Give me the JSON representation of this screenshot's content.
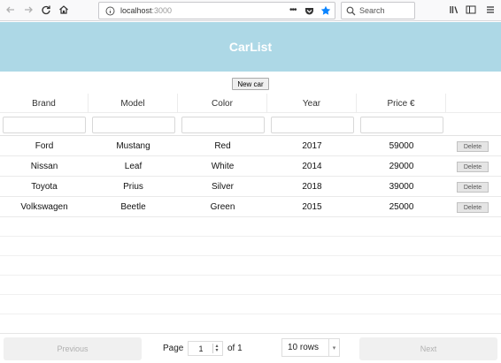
{
  "browser": {
    "url": "localhost",
    "url_port": ":3000",
    "search_placeholder": "Search",
    "icons": [
      "back-arrow-icon",
      "forward-arrow-icon",
      "reload-icon",
      "home-icon",
      "info-icon",
      "more-icon",
      "pocket-icon",
      "bookmark-star-icon",
      "search-icon",
      "library-icon",
      "sidebar-icon",
      "menu-icon"
    ]
  },
  "app": {
    "title": "CarList",
    "new_car_label": "New car",
    "header_color": "#add8e6"
  },
  "table": {
    "columns": [
      "Brand",
      "Model",
      "Color",
      "Year",
      "Price €",
      ""
    ],
    "rows": [
      {
        "brand": "Ford",
        "model": "Mustang",
        "color": "Red",
        "year": "2017",
        "price": "59000"
      },
      {
        "brand": "Nissan",
        "model": "Leaf",
        "color": "White",
        "year": "2014",
        "price": "29000"
      },
      {
        "brand": "Toyota",
        "model": "Prius",
        "color": "Silver",
        "year": "2018",
        "price": "39000"
      },
      {
        "brand": "Volkswagen",
        "model": "Beetle",
        "color": "Green",
        "year": "2015",
        "price": "25000"
      }
    ],
    "delete_label": "Delete"
  },
  "pagination": {
    "previous_label": "Previous",
    "next_label": "Next",
    "page_label": "Page",
    "page_value": "1",
    "of_label": "of 1",
    "rows_label": "10 rows"
  }
}
